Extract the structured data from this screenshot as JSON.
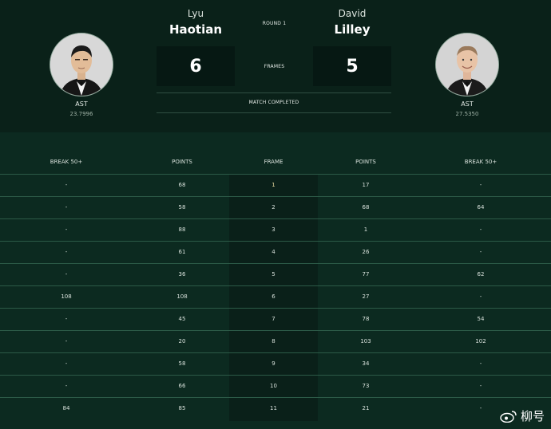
{
  "header": {
    "round_label": "ROUND 1",
    "frames_label": "FRAMES",
    "status": "MATCH COMPLETED",
    "player1": {
      "first_name": "Lyu",
      "last_name": "Haotian",
      "country": "AST",
      "ranking": "23.7996",
      "score": "6"
    },
    "player2": {
      "first_name": "David",
      "last_name": "Lilley",
      "country": "AST",
      "ranking": "27.5350",
      "score": "5"
    }
  },
  "table": {
    "headers": [
      "BREAK 50+",
      "POINTS",
      "FRAME",
      "POINTS",
      "BREAK 50+"
    ],
    "rows": [
      [
        "-",
        "68",
        "1",
        "17",
        "-"
      ],
      [
        "-",
        "58",
        "2",
        "68",
        "64"
      ],
      [
        "-",
        "88",
        "3",
        "1",
        "-"
      ],
      [
        "-",
        "61",
        "4",
        "26",
        "-"
      ],
      [
        "-",
        "36",
        "5",
        "77",
        "62"
      ],
      [
        "108",
        "108",
        "6",
        "27",
        "-"
      ],
      [
        "-",
        "45",
        "7",
        "78",
        "54"
      ],
      [
        "-",
        "20",
        "8",
        "103",
        "102"
      ],
      [
        "-",
        "58",
        "9",
        "34",
        "-"
      ],
      [
        "-",
        "66",
        "10",
        "73",
        "-"
      ],
      [
        "84",
        "85",
        "11",
        "21",
        "-"
      ]
    ]
  },
  "watermark": {
    "text": "柳号",
    "icon": "weibo-icon"
  }
}
